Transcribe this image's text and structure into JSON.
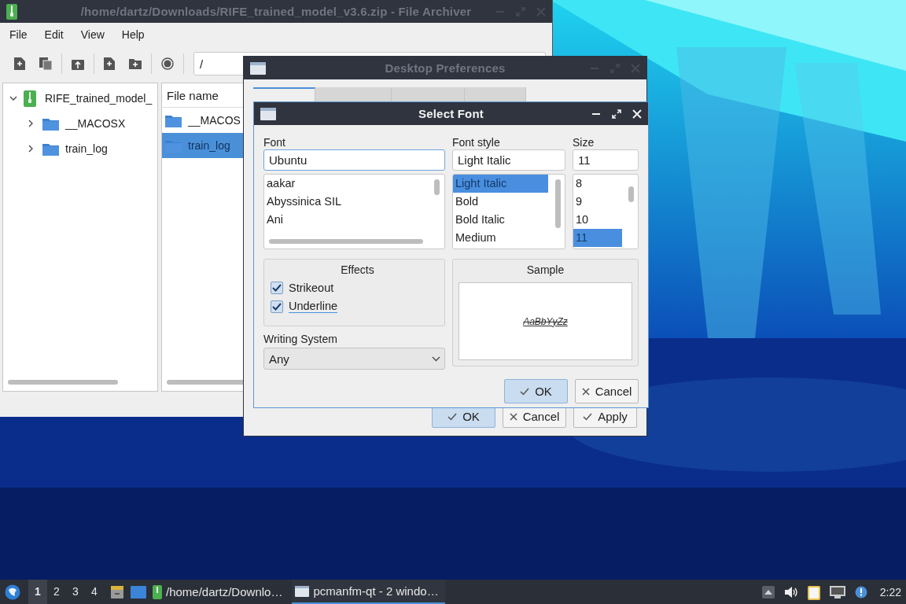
{
  "file_archiver": {
    "title": "/home/dartz/Downloads/RIFE_trained_model_v3.6.zip - File Archiver",
    "active": false,
    "menu": [
      "File",
      "Edit",
      "View",
      "Help"
    ],
    "path": "/",
    "tree": [
      {
        "label": "RIFE_trained_model_",
        "expanded": true,
        "children": [
          {
            "label": "__MACOSX",
            "expanded": false
          },
          {
            "label": "train_log",
            "expanded": false
          }
        ]
      }
    ],
    "file_list": {
      "columns": [
        "File name"
      ],
      "rows": [
        {
          "name": "__MACOS",
          "selected": false
        },
        {
          "name": "train_log",
          "selected": true
        }
      ]
    }
  },
  "desktop_preferences": {
    "title": "Desktop Preferences",
    "active": false,
    "tabs": [
      {
        "selected": true
      },
      {
        "selected": false
      },
      {
        "selected": false
      },
      {
        "selected": false
      }
    ],
    "buttons": [
      {
        "label": "OK",
        "kind": "ok",
        "default": true
      },
      {
        "label": "Cancel",
        "kind": "cancel",
        "default": false
      },
      {
        "label": "Apply",
        "kind": "apply",
        "default": false
      }
    ]
  },
  "select_font": {
    "title": "Select Font",
    "active": true,
    "font": {
      "label": "Font",
      "value": "Ubuntu",
      "items": [
        {
          "label": "aakar",
          "selected": false
        },
        {
          "label": "Abyssinica SIL",
          "selected": false
        },
        {
          "label": "Ani",
          "selected": false
        }
      ]
    },
    "style": {
      "label": "Font style",
      "value": "Light Italic",
      "items": [
        {
          "label": "Light Italic",
          "selected": true
        },
        {
          "label": "Bold",
          "selected": false
        },
        {
          "label": "Bold Italic",
          "selected": false
        },
        {
          "label": "Medium",
          "selected": false
        }
      ]
    },
    "size": {
      "label": "Size",
      "value": "11",
      "items": [
        {
          "label": "8",
          "selected": false
        },
        {
          "label": "9",
          "selected": false
        },
        {
          "label": "10",
          "selected": false
        },
        {
          "label": "11",
          "selected": true
        }
      ]
    },
    "effects": {
      "title": "Effects",
      "options": [
        {
          "label": "Strikeout",
          "checked": true,
          "focused": false
        },
        {
          "label": "Underline",
          "checked": true,
          "focused": true
        }
      ]
    },
    "writing_system": {
      "label": "Writing System",
      "value": "Any"
    },
    "sample": {
      "title": "Sample",
      "text": "AaBbYyZz"
    },
    "buttons": [
      {
        "label": "OK",
        "kind": "ok",
        "default": true
      },
      {
        "label": "Cancel",
        "kind": "cancel",
        "default": false
      }
    ]
  },
  "taskbar": {
    "workspaces": [
      {
        "label": "1",
        "selected": true
      },
      {
        "label": "2",
        "selected": false
      },
      {
        "label": "3",
        "selected": false
      },
      {
        "label": "4",
        "selected": false
      }
    ],
    "tasks": [
      {
        "label": "/home/dartz/Downlo…",
        "kind": "archiver",
        "selected": false
      },
      {
        "label": "pcmanfm-qt - 2 windo…",
        "kind": "window",
        "selected": true
      }
    ],
    "clock": "2:22"
  }
}
